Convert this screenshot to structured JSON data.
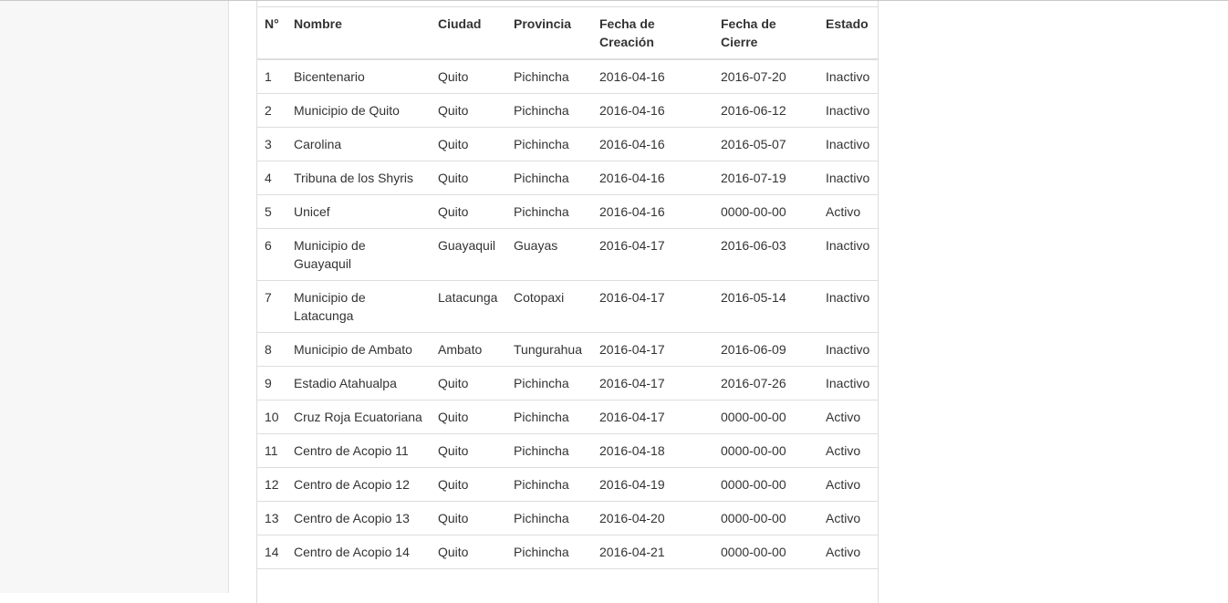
{
  "table": {
    "headers": [
      "N°",
      "Nombre",
      "Ciudad",
      "Provincia",
      "Fecha de Creación",
      "Fecha de Cierre",
      "Estado"
    ],
    "rows": [
      [
        "1",
        "Bicentenario",
        "Quito",
        "Pichincha",
        "2016-04-16",
        "2016-07-20",
        "Inactivo"
      ],
      [
        "2",
        "Municipio de Quito",
        "Quito",
        "Pichincha",
        "2016-04-16",
        "2016-06-12",
        "Inactivo"
      ],
      [
        "3",
        "Carolina",
        "Quito",
        "Pichincha",
        "2016-04-16",
        "2016-05-07",
        "Inactivo"
      ],
      [
        "4",
        "Tribuna de los Shyris",
        "Quito",
        "Pichincha",
        "2016-04-16",
        "2016-07-19",
        "Inactivo"
      ],
      [
        "5",
        "Unicef",
        "Quito",
        "Pichincha",
        "2016-04-16",
        "0000-00-00",
        "Activo"
      ],
      [
        "6",
        "Municipio de Guayaquil",
        "Guayaquil",
        "Guayas",
        "2016-04-17",
        "2016-06-03",
        "Inactivo"
      ],
      [
        "7",
        "Municipio de Latacunga",
        "Latacunga",
        "Cotopaxi",
        "2016-04-17",
        "2016-05-14",
        "Inactivo"
      ],
      [
        "8",
        "Municipio de Ambato",
        "Ambato",
        "Tungurahua",
        "2016-04-17",
        "2016-06-09",
        "Inactivo"
      ],
      [
        "9",
        "Estadio Atahualpa",
        "Quito",
        "Pichincha",
        "2016-04-17",
        "2016-07-26",
        "Inactivo"
      ],
      [
        "10",
        "Cruz Roja Ecuatoriana",
        "Quito",
        "Pichincha",
        "2016-04-17",
        "0000-00-00",
        "Activo"
      ],
      [
        "11",
        "Centro de Acopio 11",
        "Quito",
        "Pichincha",
        "2016-04-18",
        "0000-00-00",
        "Activo"
      ],
      [
        "12",
        "Centro de Acopio 12",
        "Quito",
        "Pichincha",
        "2016-04-19",
        "0000-00-00",
        "Activo"
      ],
      [
        "13",
        "Centro de Acopio 13",
        "Quito",
        "Pichincha",
        "2016-04-20",
        "0000-00-00",
        "Activo"
      ],
      [
        "14",
        "Centro de Acopio 14",
        "Quito",
        "Pichincha",
        "2016-04-21",
        "0000-00-00",
        "Activo"
      ]
    ]
  }
}
